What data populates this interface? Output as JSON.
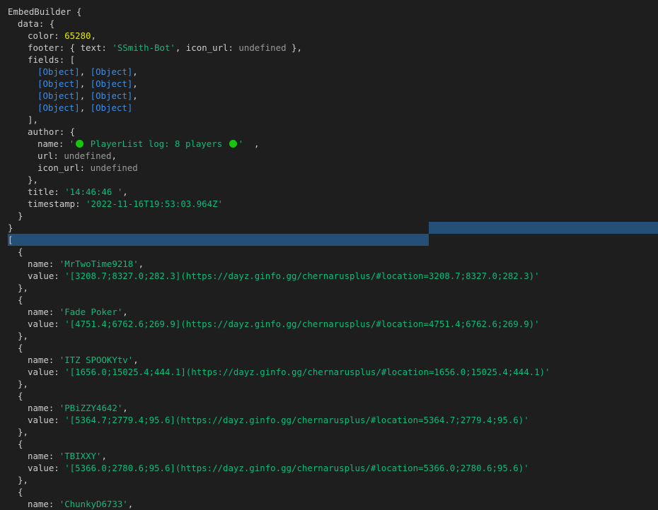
{
  "embed": {
    "class_name": "EmbedBuilder",
    "color": "65280",
    "footer_text": "'SSmith-Bot'",
    "undefined": "undefined",
    "object_label": "[Object]",
    "author_name_start": "'",
    "author_name_text": " PlayerList log: 8 players ",
    "author_name_end": "'",
    "title": "'14:46:46 '",
    "timestamp": "'2022-11-16T19:53:03.964Z'",
    "status_icon": "green-circle-icon"
  },
  "players": [
    {
      "name": "'MrTwoTime9218'",
      "value": "'[3208.7;8327.0;282.3](https://dayz.ginfo.gg/chernarusplus/#location=3208.7;8327.0;282.3)'"
    },
    {
      "name": "'Fade Poker'",
      "value": "'[4751.4;6762.6;269.9](https://dayz.ginfo.gg/chernarusplus/#location=4751.4;6762.6;269.9)'"
    },
    {
      "name": "'ITZ SPOOKYtv'",
      "value": "'[1656.0;15025.4;444.1](https://dayz.ginfo.gg/chernarusplus/#location=1656.0;15025.4;444.1)'"
    },
    {
      "name": "'PBiZZY4642'",
      "value": "'[5364.7;2779.4;95.6](https://dayz.ginfo.gg/chernarusplus/#location=5364.7;2779.4;95.6)'"
    },
    {
      "name": "'TBIXXY'",
      "value": "'[5366.0;2780.6;95.6](https://dayz.ginfo.gg/chernarusplus/#location=5366.0;2780.6;95.6)'"
    },
    {
      "name": "'ChunkyD6733'"
    }
  ]
}
